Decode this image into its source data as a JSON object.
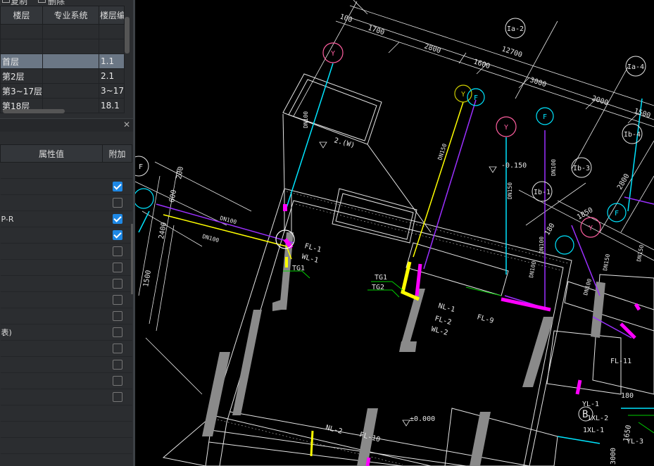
{
  "toolbar": {
    "copy_label": "复制",
    "delete_label": "删除"
  },
  "floor_table": {
    "columns": [
      "楼层",
      "专业系统",
      "楼层编"
    ],
    "rows": [
      {
        "floor": "",
        "system": "",
        "num": ""
      },
      {
        "floor": "",
        "system": "",
        "num": ""
      },
      {
        "floor": "首层",
        "system": "",
        "num": "1.1"
      },
      {
        "floor": "第2层",
        "system": "",
        "num": "2.1"
      },
      {
        "floor": "第3~17层",
        "system": "",
        "num": "3~17"
      },
      {
        "floor": "第18层",
        "system": "",
        "num": "18.1"
      }
    ],
    "selected_index": 2
  },
  "properties": {
    "columns": [
      "属性值",
      "附加"
    ],
    "rows": [
      {
        "value": "",
        "checkbox": null
      },
      {
        "value": "",
        "checkbox": true
      },
      {
        "value": "",
        "checkbox": false
      },
      {
        "value": "P-R",
        "checkbox": true
      },
      {
        "value": "",
        "checkbox": true
      },
      {
        "value": "",
        "checkbox": false
      },
      {
        "value": "",
        "checkbox": false
      },
      {
        "value": "",
        "checkbox": false
      },
      {
        "value": "",
        "checkbox": false
      },
      {
        "value": "",
        "checkbox": false
      },
      {
        "value": "表)",
        "checkbox": false
      },
      {
        "value": "",
        "checkbox": false
      },
      {
        "value": "",
        "checkbox": false
      },
      {
        "value": "",
        "checkbox": false
      },
      {
        "value": "",
        "checkbox": false
      },
      {
        "value": "",
        "checkbox": null
      },
      {
        "value": "",
        "checkbox": null
      },
      {
        "value": "",
        "checkbox": null
      },
      {
        "value": "",
        "checkbox": null
      },
      {
        "value": "",
        "checkbox": null
      }
    ]
  },
  "drawing": {
    "dimensions": [
      "100",
      "1700",
      "2800",
      "12700",
      "1600",
      "3000",
      "2000",
      "1500",
      "2800",
      "1850",
      "180",
      "600",
      "200",
      "2400",
      "1500",
      "3000",
      "1650",
      "180"
    ],
    "axis_labels": [
      "Ia-2",
      "Ia-4",
      "Ib-4",
      "Ib-3",
      "Ib-1",
      "F"
    ],
    "riser_symbols": [
      "Y",
      "Y",
      "F",
      "Y",
      "F",
      "Y",
      "F"
    ],
    "pipe_labels": [
      "FL-1",
      "WL-1",
      "TG1",
      "TG1",
      "TG2",
      "NL-1",
      "FL-2",
      "WL-2",
      "FL-9",
      "FL-11",
      "YL-1",
      "1XL-2",
      "1XL-1",
      "YL-3",
      "NL-2",
      "FL-10"
    ],
    "pipe_sizes": [
      "DN100",
      "DN100",
      "DN100",
      "DN150",
      "DN150",
      "DN100",
      "DN100",
      "DN150",
      "DN150",
      "DN100",
      "DN100"
    ],
    "elevations": [
      "2.(W)",
      "-0.150",
      "±0.000"
    ],
    "axis_bubble": "B",
    "colors": {
      "yellow": "#ffff00",
      "cyan": "#00e5ff",
      "magenta": "#ff00ff",
      "violet": "#9b30ff",
      "green": "#00d000",
      "gray": "#8a8a8a",
      "white": "#e6e6e6",
      "pink": "#ff5fa0"
    }
  }
}
